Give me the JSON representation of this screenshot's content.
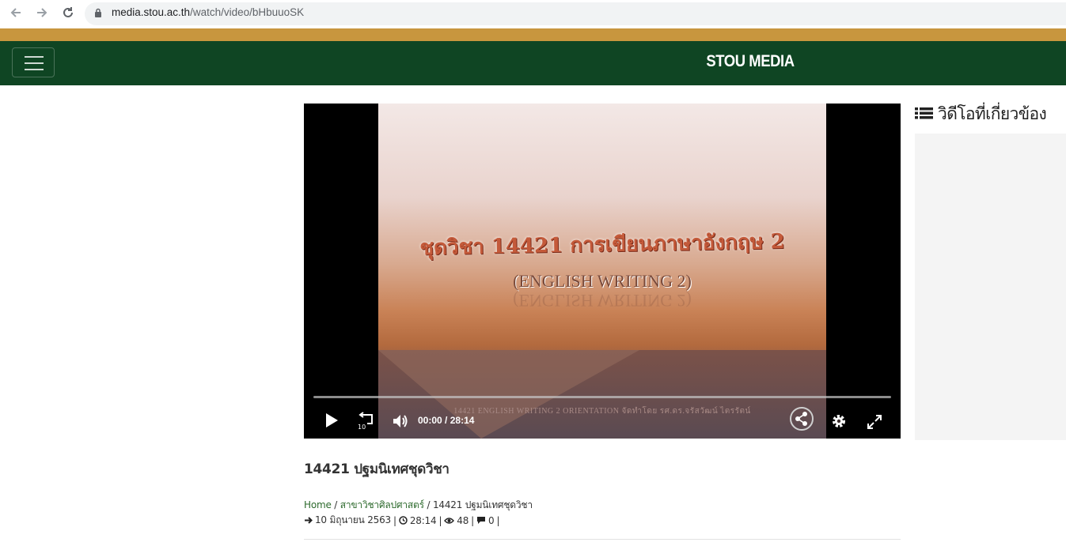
{
  "browser": {
    "url_host": "media.stou.ac.th",
    "url_path": "/watch/video/bHbuuoSK"
  },
  "header": {
    "brand": "STOU MEDIA"
  },
  "player": {
    "slide_title_thai": "ชุดวิชา 14421 การเขียนภาษาอังกฤษ 2",
    "slide_title_en": "(ENGLISH WRITING 2)",
    "slide_caption": "14421 ENGLISH WRITING 2 ORIENTATION จัดทำโดย รศ.ดร.จรัสวัฒน์ ไตรรัตน์",
    "current_time": "00:00",
    "time_separator": "/",
    "duration": "28:14",
    "progress": 0,
    "rewind_seconds": "10"
  },
  "video": {
    "title": "14421 ปฐมนิเทศชุดวิชา",
    "breadcrumb": {
      "home": "Home",
      "sep": "/",
      "category": "สาขาวิชาศิลปศาสตร์",
      "current": "14421 ปฐมนิเทศชุดวิชา"
    },
    "meta": {
      "date": "10 มิถุนายน 2563",
      "duration": "28:14",
      "views": "48",
      "comments": "0",
      "sep": "|"
    }
  },
  "sidebar": {
    "related_title": "วิดีโอที่เกี่ยวข้อง"
  },
  "colors": {
    "header_green": "#0f4523",
    "gold_strip": "#c8963e",
    "link_green": "#2d6a2d"
  }
}
